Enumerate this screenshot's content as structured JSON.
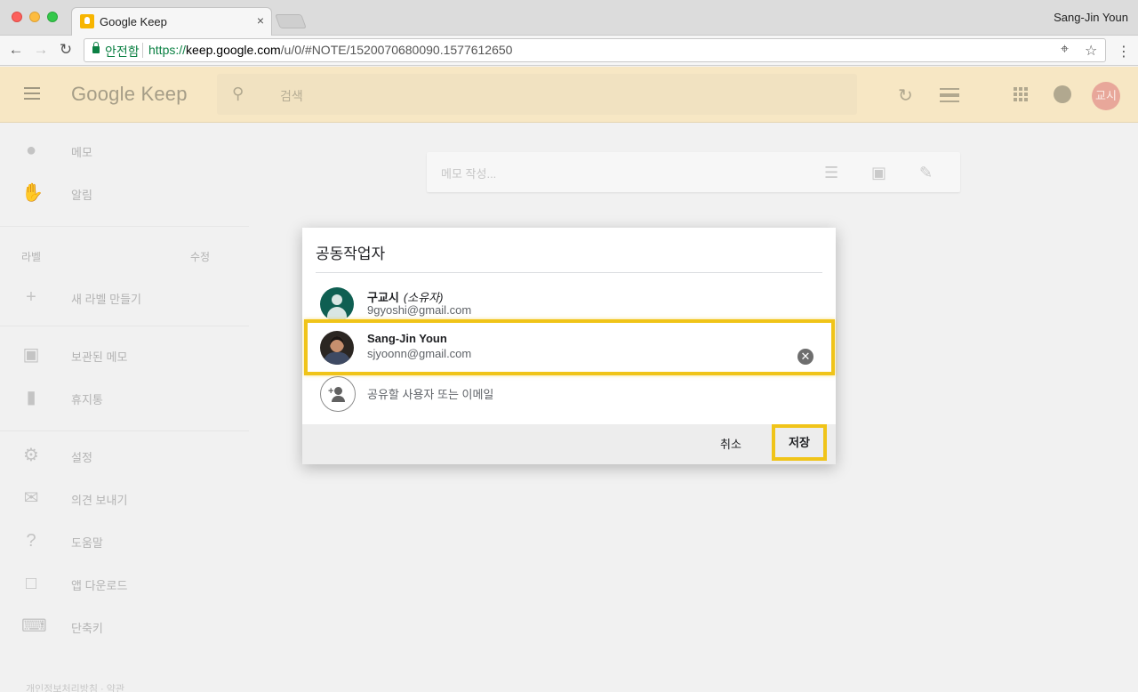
{
  "browser": {
    "tab_title": "Google Keep",
    "tab_close": "×",
    "profile_name": "Sang-Jin Youn",
    "secure_label": "안전함",
    "url_scheme": "https://",
    "url_host": "keep.google.com",
    "url_path": "/u/0/#NOTE/1520070680090.1577612650",
    "nav": {
      "back": "←",
      "forward": "→",
      "reload": "↻"
    },
    "omni_icons": {
      "location": "⌖",
      "bookmark": "☆",
      "menu": "⋮"
    }
  },
  "app": {
    "logo": "Google Keep",
    "search_placeholder": "검색",
    "avatar_initials": "교시"
  },
  "sidebar": {
    "items": [
      {
        "label": "메모",
        "icon": "lightbulb-icon"
      },
      {
        "label": "알림",
        "icon": "reminder-hand-icon"
      }
    ],
    "labels_heading": "라벨",
    "labels_edit": "수정",
    "new_label": "새 라벨 만들기",
    "more_items": [
      {
        "label": "보관된 메모",
        "icon": "archive-icon"
      },
      {
        "label": "휴지통",
        "icon": "trash-icon"
      }
    ],
    "settings_items": [
      {
        "label": "설정",
        "icon": "gear-icon"
      },
      {
        "label": "의견 보내기",
        "icon": "feedback-icon"
      },
      {
        "label": "도움말",
        "icon": "help-icon"
      },
      {
        "label": "앱 다운로드",
        "icon": "devices-icon"
      },
      {
        "label": "단축키",
        "icon": "keyboard-icon"
      }
    ],
    "footer": "개인정보처리방침 · 약관"
  },
  "composer": {
    "placeholder": "메모 작성..."
  },
  "dialog": {
    "title": "공동작업자",
    "collaborators": [
      {
        "name": "구교시",
        "role": "(소유자)",
        "email": "9gyoshi@gmail.com"
      },
      {
        "name": "Sang-Jin Youn",
        "role": "",
        "email": "sjyoonn@gmail.com"
      }
    ],
    "remove_symbol": "✕",
    "add_placeholder": "공유할 사용자 또는 이메일",
    "cancel_label": "취소",
    "save_label": "저장"
  },
  "colors": {
    "highlight": "#f0c419",
    "keep_header": "#f7e7c4",
    "secure_green": "#0b8043"
  }
}
